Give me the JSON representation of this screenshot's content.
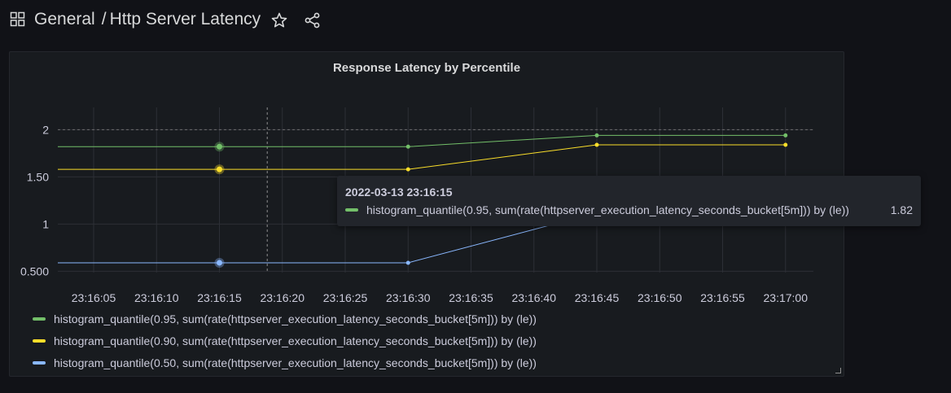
{
  "header": {
    "folder": "General",
    "separator": "/",
    "dashboard_title": "Http Server Latency"
  },
  "panel": {
    "title": "Response Latency by Percentile"
  },
  "colors": {
    "p95": "#73bf69",
    "p90": "#fade2a",
    "p50": "#8ab8ff",
    "threshold": "#6e6e6e",
    "grid": "#2c2f36"
  },
  "chart_data": {
    "type": "line",
    "title": "Response Latency by Percentile",
    "x": [
      "23:16:15",
      "23:16:30",
      "23:16:45",
      "23:17:00"
    ],
    "x_tick_labels": [
      "23:16:05",
      "23:16:10",
      "23:16:15",
      "23:16:20",
      "23:16:25",
      "23:16:30",
      "23:16:35",
      "23:16:40",
      "23:16:45",
      "23:16:50",
      "23:16:55",
      "23:17:00"
    ],
    "y_tick_labels": [
      "0.500",
      "1",
      "1.50",
      "2"
    ],
    "y_ticks": [
      0.5,
      1,
      1.5,
      2
    ],
    "threshold": 2,
    "series": [
      {
        "name": "histogram_quantile(0.95, sum(rate(httpserver_execution_latency_seconds_bucket[5m])) by (le))",
        "color_key": "p95",
        "values": [
          1.82,
          1.82,
          1.94,
          1.94
        ]
      },
      {
        "name": "histogram_quantile(0.90, sum(rate(httpserver_execution_latency_seconds_bucket[5m])) by (le))",
        "color_key": "p90",
        "values": [
          1.58,
          1.58,
          1.84,
          1.84
        ]
      },
      {
        "name": "histogram_quantile(0.50, sum(rate(httpserver_execution_latency_seconds_bucket[5m])) by (le))",
        "color_key": "p50",
        "values": [
          0.59,
          0.59,
          1.12,
          1.12
        ]
      }
    ],
    "legend_position": "bottom",
    "hover_index": 0,
    "grid": true
  },
  "tooltip": {
    "timestamp": "2022-03-13 23:16:15",
    "series_label": "histogram_quantile(0.95, sum(rate(httpserver_execution_latency_seconds_bucket[5m])) by (le))",
    "value": "1.82"
  },
  "icons": [
    "dashboard-grid-icon",
    "star-icon",
    "share-icon",
    "resize-handle-icon"
  ]
}
